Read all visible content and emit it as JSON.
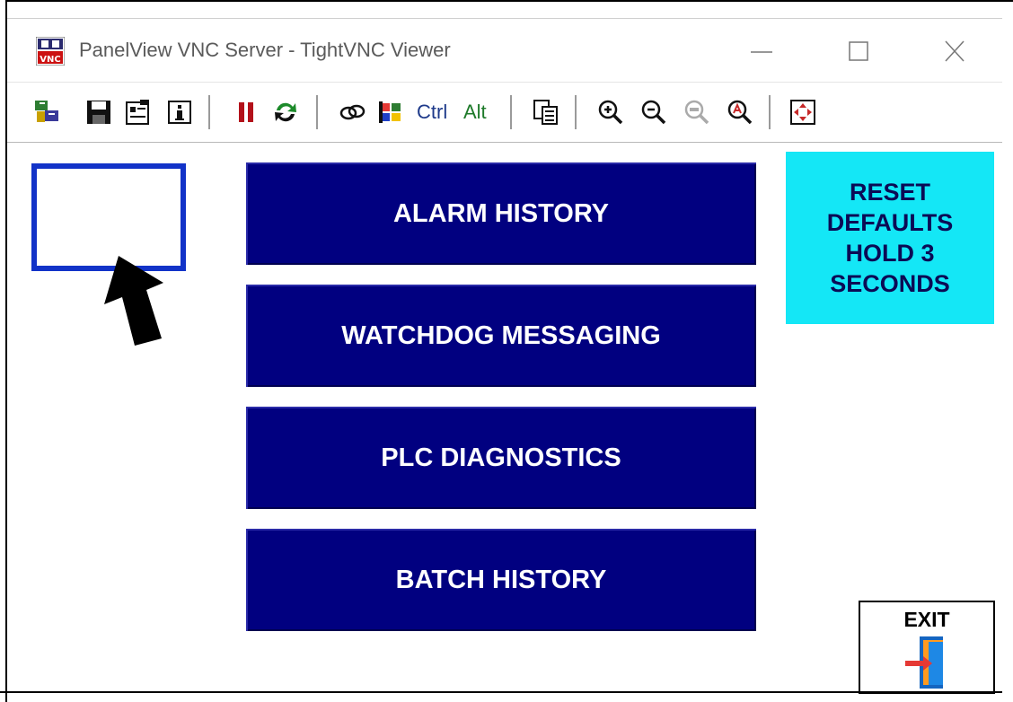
{
  "window": {
    "title": "PanelView VNC Server - TightVNC Viewer",
    "app_icon": "vnc-icon"
  },
  "toolbar": {
    "ctrl_label": "Ctrl",
    "alt_label": "Alt",
    "icons": [
      "new-connection-icon",
      "save-icon",
      "options-icon",
      "info-icon",
      "pause-icon",
      "refresh-icon",
      "ctrl-alt-del-icon",
      "start-menu-icon",
      "clipboard-icon",
      "zoom-in-icon",
      "zoom-out-icon",
      "zoom-100-icon",
      "zoom-auto-icon",
      "fullscreen-icon"
    ]
  },
  "main": {
    "buttons": [
      {
        "label": "ALARM HISTORY"
      },
      {
        "label": "WATCHDOG MESSAGING"
      },
      {
        "label": "PLC DIAGNOSTICS"
      },
      {
        "label": "BATCH HISTORY"
      }
    ],
    "reset": {
      "line1": "RESET",
      "line2": "DEFAULTS",
      "line3": "HOLD 3",
      "line4": "SECONDS"
    },
    "exit_label": "EXIT"
  },
  "colors": {
    "button_bg": "#010080",
    "reset_bg": "#14e7f6",
    "highlight_box": "#1233c8"
  }
}
